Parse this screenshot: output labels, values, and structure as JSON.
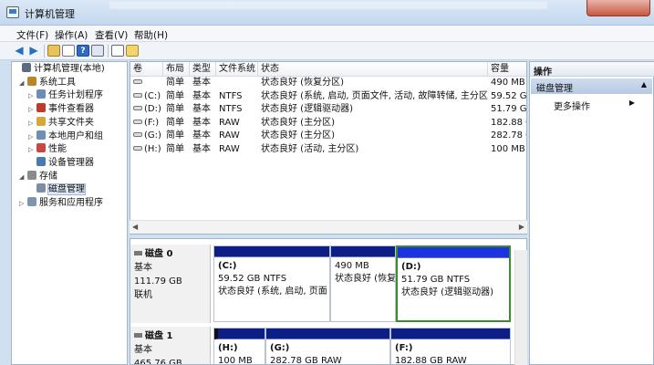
{
  "window": {
    "title": "计算机管理"
  },
  "menu": [
    "文件(F)",
    "操作(A)",
    "查看(V)",
    "帮助(H)"
  ],
  "tree": [
    {
      "label": "计算机管理(本地)",
      "level": 0,
      "exp": "",
      "icon": "computer-icon",
      "color": "#5b6b84"
    },
    {
      "label": "系统工具",
      "level": 1,
      "exp": "◢",
      "icon": "tools-icon",
      "color": "#b8862b"
    },
    {
      "label": "任务计划程序",
      "level": 2,
      "exp": "▷",
      "icon": "clock-icon",
      "color": "#6d8db8"
    },
    {
      "label": "事件查看器",
      "level": 2,
      "exp": "▷",
      "icon": "event-viewer-icon",
      "color": "#c0392b"
    },
    {
      "label": "共享文件夹",
      "level": 2,
      "exp": "▷",
      "icon": "shared-folder-icon",
      "color": "#d6a83a"
    },
    {
      "label": "本地用户和组",
      "level": 2,
      "exp": "▷",
      "icon": "users-icon",
      "color": "#6f8fb4"
    },
    {
      "label": "性能",
      "level": 2,
      "exp": "▷",
      "icon": "performance-icon",
      "color": "#c44"
    },
    {
      "label": "设备管理器",
      "level": 2,
      "exp": "",
      "icon": "device-manager-icon",
      "color": "#4a79b0"
    },
    {
      "label": "存储",
      "level": 1,
      "exp": "◢",
      "icon": "storage-icon",
      "color": "#8c8c8c"
    },
    {
      "label": "磁盘管理",
      "level": 2,
      "exp": "",
      "icon": "disk-icon",
      "color": "#7a8ea8",
      "selected": true
    },
    {
      "label": "服务和应用程序",
      "level": 1,
      "exp": "▷",
      "icon": "services-icon",
      "color": "#7f95ad"
    }
  ],
  "volumes": {
    "headers": [
      "卷",
      "布局",
      "类型",
      "文件系统",
      "状态",
      "容量"
    ],
    "rows": [
      {
        "vol": "",
        "layout": "简单",
        "type": "基本",
        "fs": "",
        "status": "状态良好 (恢复分区)",
        "cap": "490 MB"
      },
      {
        "vol": "(C:)",
        "layout": "简单",
        "type": "基本",
        "fs": "NTFS",
        "status": "状态良好 (系统, 启动, 页面文件, 活动, 故障转储, 主分区)",
        "cap": "59.52 GB"
      },
      {
        "vol": "(D:)",
        "layout": "简单",
        "type": "基本",
        "fs": "NTFS",
        "status": "状态良好 (逻辑驱动器)",
        "cap": "51.79 GB"
      },
      {
        "vol": "(F:)",
        "layout": "简单",
        "type": "基本",
        "fs": "RAW",
        "status": "状态良好 (主分区)",
        "cap": "182.88 GB"
      },
      {
        "vol": "(G:)",
        "layout": "简单",
        "type": "基本",
        "fs": "RAW",
        "status": "状态良好 (主分区)",
        "cap": "282.78 GB"
      },
      {
        "vol": "(H:)",
        "layout": "简单",
        "type": "基本",
        "fs": "RAW",
        "status": "状态良好 (活动, 主分区)",
        "cap": "100 MB"
      }
    ]
  },
  "disks": [
    {
      "name": "磁盘 0",
      "type": "基本",
      "size": "111.79 GB",
      "status": "联机",
      "partitions": [
        {
          "label": "(C:)",
          "size": "59.52 GB NTFS",
          "status": "状态良好 (系统, 启动, 页面"
        },
        {
          "label": "",
          "size": "490 MB",
          "status": "状态良好 (恢复"
        },
        {
          "label": "(D:)",
          "size": "51.79 GB NTFS",
          "status": "状态良好 (逻辑驱动器)"
        }
      ]
    },
    {
      "name": "磁盘 1",
      "type": "基本",
      "size": "465.76 GB",
      "partitions": [
        {
          "label": "(H:)",
          "size": "100 MB"
        },
        {
          "label": "(G:)",
          "size": "282.78 GB RAW"
        },
        {
          "label": "(F:)",
          "size": "182.88 GB RAW"
        }
      ]
    }
  ],
  "actions": {
    "header": "操作",
    "section": "磁盘管理",
    "more": "更多操作"
  },
  "colors": {
    "primary_partition": "#0d1e86",
    "logical_drive": "#1d33e0",
    "extended_border": "#3a8c2e"
  }
}
